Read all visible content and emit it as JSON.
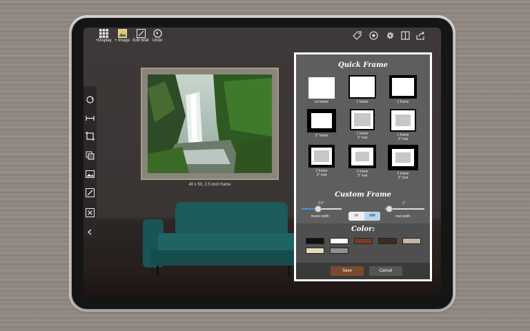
{
  "toolbar": {
    "display_label": "+Display",
    "image_label": "+ Image",
    "edit_wall_label": "Edit Wall",
    "undo_label": "Undo"
  },
  "toolbar_right_icons": [
    "tag-icon",
    "help-icon",
    "gear-icon",
    "book-icon",
    "share-icon"
  ],
  "left_tools": [
    "rotate-icon",
    "resize-width-icon",
    "crop-icon",
    "layers-icon",
    "image-icon",
    "edit-pencil-icon",
    "close-icon"
  ],
  "artwork": {
    "caption": "40 x 50, 2.5 inch frame"
  },
  "quick_frame": {
    "title": "Quick Frame",
    "options": [
      {
        "label": "no frame",
        "sub": ""
      },
      {
        "label": "1 frame",
        "sub": ""
      },
      {
        "label": "2 frame",
        "sub": ""
      },
      {
        "label": "3\" frame",
        "sub": ""
      },
      {
        "label": "1 frame",
        "sub": "2\" mat"
      },
      {
        "label": "1 frame",
        "sub": "3\" mat"
      },
      {
        "label": "2 frame",
        "sub": "2\" mat"
      },
      {
        "label": "2 frame",
        "sub": "3\" mat"
      },
      {
        "label": "3 frame",
        "sub": "3\" mat"
      }
    ]
  },
  "custom_frame": {
    "title": "Custom Frame",
    "frame_width_value": "2.5\"",
    "frame_width_label": "frame width",
    "frame_width_fraction": 0.4,
    "mat_width_value": "1\"",
    "mat_width_label": "mat width",
    "mat_width_fraction": 0.05,
    "unit_in": "IN",
    "unit_mm": "MM",
    "unit_selected": "MM"
  },
  "color": {
    "title": "Color:",
    "swatches": [
      "#111111",
      "#ffffff",
      "#7a3b22",
      "#3f2a22",
      "#c9b49e",
      "#e3dbb8",
      "#909090"
    ]
  },
  "actions": {
    "save_label": "Save",
    "cancel_label": "Cancel",
    "save_color": "#7a4a2e",
    "cancel_color": "#555555"
  }
}
